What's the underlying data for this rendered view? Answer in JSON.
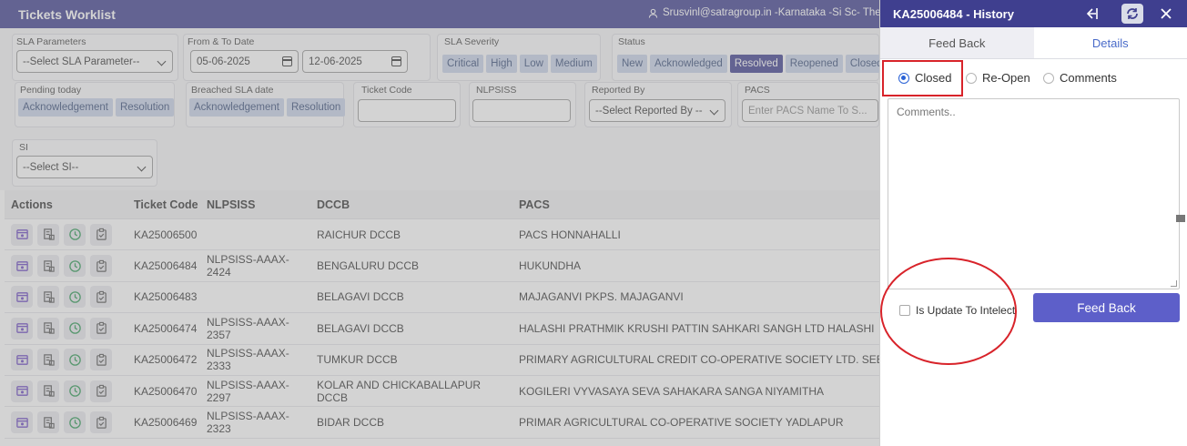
{
  "app": {
    "title": "Tickets Worklist",
    "user": "Srusvinl@satragroup.in -Karnataka -Si Sc- The So"
  },
  "filters": {
    "sla_parameters": {
      "label": "SLA Parameters",
      "value": "--Select SLA Parameter--"
    },
    "date_range": {
      "label": "From & To Date",
      "from": "05-06-2025",
      "to": "12-06-2025"
    },
    "sla_severity": {
      "label": "SLA Severity",
      "options": [
        "Critical",
        "High",
        "Low",
        "Medium"
      ]
    },
    "status": {
      "label": "Status",
      "options": [
        "New",
        "Acknowledged",
        "Resolved",
        "Reopened",
        "Closed"
      ],
      "active": "Resolved"
    },
    "pending_today": {
      "label": "Pending today",
      "options": [
        "Acknowledgement",
        "Resolution"
      ]
    },
    "breached_sla": {
      "label": "Breached SLA date",
      "options": [
        "Acknowledgement",
        "Resolution"
      ]
    },
    "ticket_code": {
      "label": "Ticket Code",
      "value": ""
    },
    "nlpsiss": {
      "label": "NLPSISS",
      "value": ""
    },
    "reported_by": {
      "label": "Reported By",
      "value": "--Select Reported By --"
    },
    "pacs": {
      "label": "PACS",
      "placeholder": "Enter PACS Name To S..."
    },
    "si": {
      "label": "SI",
      "value": "--Select SI--"
    }
  },
  "table": {
    "headers": [
      "Actions",
      "Ticket Code",
      "NLPSISS",
      "DCCB",
      "PACS"
    ],
    "rows": [
      {
        "code": "KA25006500",
        "nlpsiss": "",
        "dccb": "RAICHUR DCCB",
        "pacs": "PACS HONNAHALLI"
      },
      {
        "code": "KA25006484",
        "nlpsiss": "NLPSISS-AAAX-2424",
        "dccb": "BENGALURU DCCB",
        "pacs": "HUKUNDHA"
      },
      {
        "code": "KA25006483",
        "nlpsiss": "",
        "dccb": "BELAGAVI DCCB",
        "pacs": "MAJAGANVI PKPS. MAJAGANVI"
      },
      {
        "code": "KA25006474",
        "nlpsiss": "NLPSISS-AAAX-2357",
        "dccb": "BELAGAVI DCCB",
        "pacs": "HALASHI PRATHMIK KRUSHI PATTIN SAHKARI SANGH LTD HALASHI"
      },
      {
        "code": "KA25006472",
        "nlpsiss": "NLPSISS-AAAX-2333",
        "dccb": "TUMKUR DCCB",
        "pacs": "PRIMARY AGRICULTURAL CREDIT CO-OPERATIVE SOCIETY LTD. SEEBI"
      },
      {
        "code": "KA25006470",
        "nlpsiss": "NLPSISS-AAAX-2297",
        "dccb": "KOLAR AND CHICKABALLAPUR DCCB",
        "pacs": "KOGILERI VYVASAYA SEVA SAHAKARA SANGA NIYAMITHA"
      },
      {
        "code": "KA25006469",
        "nlpsiss": "NLPSISS-AAAX-2323",
        "dccb": "BIDAR DCCB",
        "pacs": "PRIMAR AGRICULTURAL CO-OPERATIVE SOCIETY YADLAPUR"
      }
    ]
  },
  "panel": {
    "title": "KA25006484 - History",
    "tabs": [
      "Feed Back",
      "Details"
    ],
    "radios": [
      "Closed",
      "Re-Open",
      "Comments"
    ],
    "selected_radio": "Closed",
    "comments_placeholder": "Comments..",
    "checkbox_label": "Is Update To Intelect",
    "submit_label": "Feed Back"
  },
  "colors": {
    "primary": "#3f3f8f",
    "button": "#5d5fc9",
    "annotation": "#d8232a",
    "radio": "#2a62d6"
  }
}
